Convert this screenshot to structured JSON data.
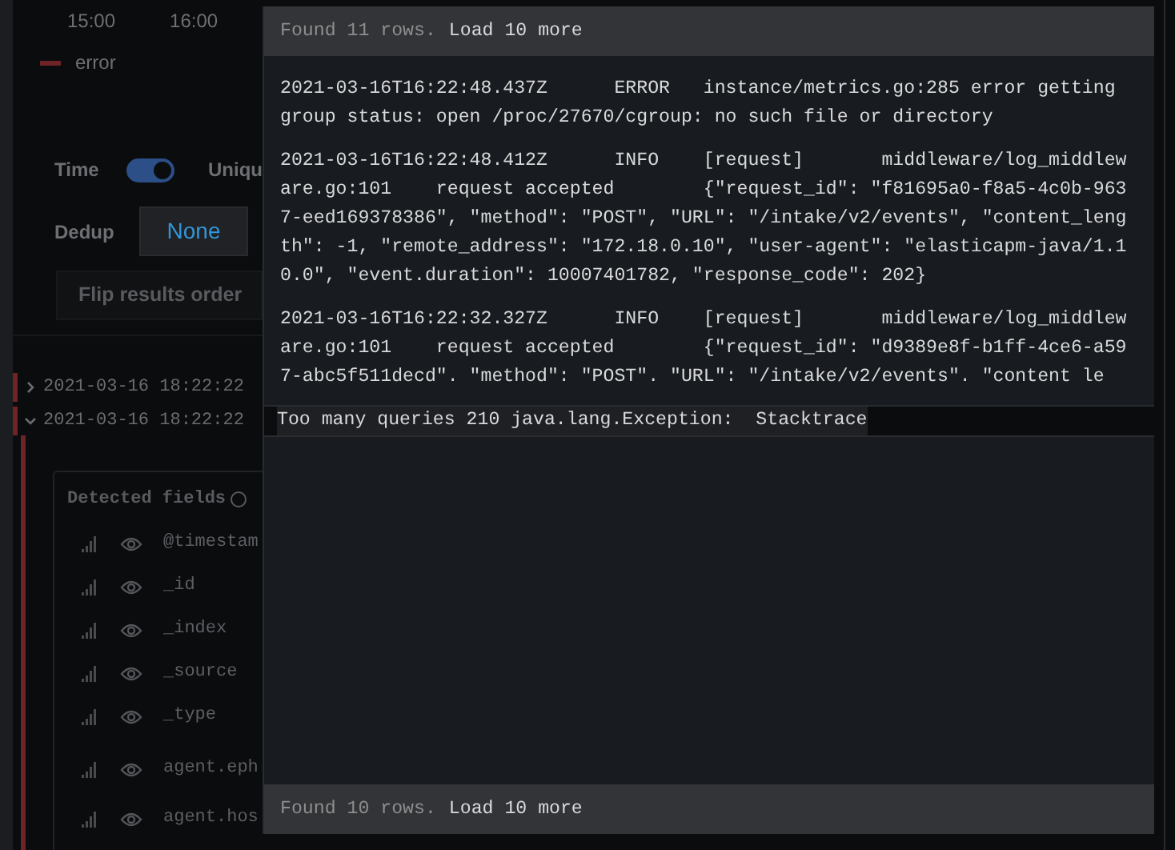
{
  "chart": {
    "x_labels": [
      "15:00",
      "16:00"
    ],
    "legend": [
      {
        "label": "error"
      }
    ]
  },
  "options": {
    "time": {
      "label": "Time",
      "on": true
    },
    "unique_label": "Uniqu",
    "dedup": {
      "label": "Dedup",
      "options": [
        {
          "label": "None",
          "selected": true
        }
      ]
    },
    "flip_button": "Flip results order"
  },
  "log_rows": [
    {
      "time": "2021-03-16 18:22:22",
      "expanded": false
    },
    {
      "time": "2021-03-16 18:22:22",
      "expanded": true
    }
  ],
  "detected_fields": {
    "title": "Detected fields",
    "fields": [
      "@timestam",
      "_id",
      "_index",
      "_source",
      "_type",
      "agent.eph",
      "agent.hos"
    ]
  },
  "context_panel": {
    "top_bar": {
      "found": "Found 11 rows.",
      "load": "Load 10 more"
    },
    "entries": [
      "2021-03-16T16:22:48.437Z      ERROR   instance/metrics.go:285 error getting group status: open /proc/27670/cgroup: no such file or directory",
      "2021-03-16T16:22:48.412Z      INFO    [request]       middleware/log_middleware.go:101    request accepted        {\"request_id\": \"f81695a0-f8a5-4c0b-9637-eed169378386\", \"method\": \"POST\", \"URL\": \"/intake/v2/events\", \"content_length\": -1, \"remote_address\": \"172.18.0.10\", \"user-agent\": \"elasticapm-java/1.10.0\", \"event.duration\": 10007401782, \"response_code\": 202}",
      "2021-03-16T16:22:32.327Z      INFO    [request]       middleware/log_middleware.go:101    request accepted        {\"request_id\": \"d9389e8f-b1ff-4ce6-a597-abc5f511decd\". \"method\": \"POST\". \"URL\": \"/intake/v2/events\". \"content le"
    ],
    "highlight_row": "Too many queries 210 java.lang.Exception:  Stacktrace",
    "bottom_bar": {
      "found": "Found 10 rows.",
      "load": "Load 10 more"
    }
  }
}
